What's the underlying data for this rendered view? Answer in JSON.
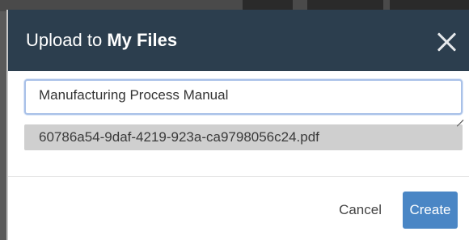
{
  "dialog": {
    "title_prefix": "Upload to",
    "title_target": "My Files",
    "close_icon": "close-icon"
  },
  "form": {
    "name_value": "Manufacturing Process Manual",
    "file_name": "60786a54-9daf-4219-923a-ca9798056c24.pdf"
  },
  "actions": {
    "cancel_label": "Cancel",
    "create_label": "Create"
  },
  "colors": {
    "header_bg": "#2c3e4e",
    "primary": "#4a86c5",
    "file_chip_bg": "#cfcfcf"
  }
}
